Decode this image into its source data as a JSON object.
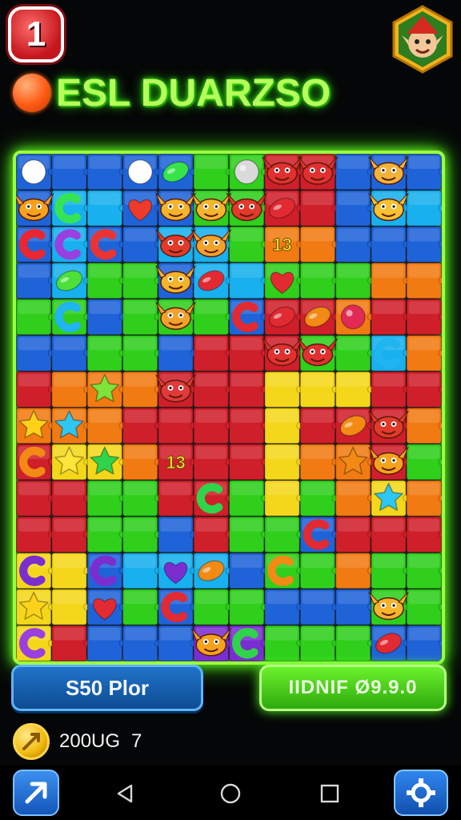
{
  "header": {
    "level_badge": "1",
    "title": "ESL DUARZSO",
    "avatar_icon": "elf-avatar-icon",
    "title_orb_icon": "orange-orb-icon"
  },
  "board": {
    "rows": 14,
    "cols": 12,
    "grid": [
      [
        "B",
        "B",
        "B",
        "B",
        "B",
        "G",
        "G",
        "R",
        "R",
        "B",
        "B",
        "B"
      ],
      [
        "B",
        "C",
        "C",
        "B",
        "B",
        "G",
        "G",
        "R",
        "R",
        "B",
        "C",
        "C"
      ],
      [
        "B",
        "C",
        "B",
        "B",
        "C",
        "C",
        "G",
        "O",
        "O",
        "B",
        "B",
        "B"
      ],
      [
        "B",
        "C",
        "G",
        "G",
        "B",
        "C",
        "C",
        "G",
        "G",
        "G",
        "O",
        "O"
      ],
      [
        "G",
        "G",
        "B",
        "G",
        "G",
        "G",
        "B",
        "R",
        "R",
        "O",
        "R",
        "R"
      ],
      [
        "B",
        "B",
        "G",
        "G",
        "B",
        "R",
        "R",
        "R",
        "G",
        "G",
        "C",
        "O"
      ],
      [
        "R",
        "O",
        "O",
        "O",
        "R",
        "R",
        "R",
        "Y",
        "Y",
        "Y",
        "R",
        "R"
      ],
      [
        "O",
        "O",
        "O",
        "R",
        "R",
        "R",
        "R",
        "Y",
        "R",
        "R",
        "R",
        "O"
      ],
      [
        "R",
        "Y",
        "Y",
        "O",
        "R",
        "R",
        "R",
        "Y",
        "O",
        "O",
        "R",
        "G"
      ],
      [
        "R",
        "R",
        "G",
        "G",
        "R",
        "R",
        "G",
        "Y",
        "G",
        "O",
        "Y",
        "O"
      ],
      [
        "R",
        "R",
        "G",
        "G",
        "B",
        "R",
        "G",
        "G",
        "B",
        "R",
        "R",
        "R"
      ],
      [
        "Y",
        "Y",
        "B",
        "C",
        "C",
        "C",
        "B",
        "G",
        "G",
        "O",
        "G",
        "G"
      ],
      [
        "Y",
        "Y",
        "B",
        "G",
        "B",
        "G",
        "G",
        "B",
        "B",
        "B",
        "G",
        "G"
      ],
      [
        "Y",
        "R",
        "B",
        "B",
        "B",
        "P",
        "P",
        "G",
        "G",
        "G",
        "B",
        "B"
      ]
    ],
    "colors": {
      "B": "#1f63d8",
      "C": "#18b0ee",
      "G": "#2fcf1c",
      "R": "#cf1f2a",
      "O": "#f27a12",
      "Y": "#f4d71a",
      "P": "#7a2ed0"
    },
    "pieces": [
      {
        "r": 0,
        "c": 0,
        "icon": "wave-ghost-icon"
      },
      {
        "r": 0,
        "c": 3,
        "icon": "ring-candy-icon"
      },
      {
        "r": 0,
        "c": 4,
        "icon": "jelly-bean-icon",
        "color": "#37e34a"
      },
      {
        "r": 0,
        "c": 6,
        "icon": "shell-icon",
        "color": "#dadada"
      },
      {
        "r": 0,
        "c": 7,
        "icon": "crab-monster-icon",
        "color": "#e23030"
      },
      {
        "r": 0,
        "c": 8,
        "icon": "crab-monster-icon",
        "color": "#e23030"
      },
      {
        "r": 0,
        "c": 10,
        "icon": "crab-monster-icon",
        "color": "#f1b43a"
      },
      {
        "r": 1,
        "c": 0,
        "icon": "crab-monster-icon",
        "color": "#f7a21c"
      },
      {
        "r": 1,
        "c": 1,
        "icon": "claw-candy-icon",
        "color": "#34e454"
      },
      {
        "r": 1,
        "c": 3,
        "icon": "heart-candy-icon",
        "color": "#ee3a2a"
      },
      {
        "r": 1,
        "c": 4,
        "icon": "crab-monster-icon",
        "color": "#f5b42a"
      },
      {
        "r": 1,
        "c": 5,
        "icon": "crab-monster-icon",
        "color": "#f3b52b"
      },
      {
        "r": 1,
        "c": 6,
        "icon": "crab-monster-icon",
        "color": "#e23a2a"
      },
      {
        "r": 1,
        "c": 7,
        "icon": "bean-candy-icon",
        "color": "#e22a33"
      },
      {
        "r": 1,
        "c": 10,
        "icon": "crab-monster-icon",
        "color": "#f7c12f"
      },
      {
        "r": 2,
        "c": 0,
        "icon": "hook-candy-icon",
        "color": "#ea2631"
      },
      {
        "r": 2,
        "c": 1,
        "icon": "hook-candy-icon",
        "color": "#9a3fe0"
      },
      {
        "r": 2,
        "c": 2,
        "icon": "hook-candy-icon",
        "color": "#ea3434"
      },
      {
        "r": 2,
        "c": 4,
        "icon": "crab-monster-icon",
        "color": "#e23a2a"
      },
      {
        "r": 2,
        "c": 5,
        "icon": "crab-monster-icon",
        "color": "#f1a22b"
      },
      {
        "r": 2,
        "c": 7,
        "icon": "number-candy-icon",
        "label": "13",
        "color": "#ffe43a"
      },
      {
        "r": 3,
        "c": 1,
        "icon": "jelly-bean-icon",
        "color": "#4ce038"
      },
      {
        "r": 3,
        "c": 4,
        "icon": "crab-monster-icon",
        "color": "#f3b52b"
      },
      {
        "r": 3,
        "c": 5,
        "icon": "shoe-candy-icon",
        "color": "#e22a33"
      },
      {
        "r": 3,
        "c": 7,
        "icon": "apple-candy-icon",
        "color": "#e22a33"
      },
      {
        "r": 4,
        "c": 1,
        "icon": "hook-candy-icon",
        "color": "#20b4f0"
      },
      {
        "r": 4,
        "c": 4,
        "icon": "crab-monster-icon",
        "color": "#f1a22b"
      },
      {
        "r": 4,
        "c": 6,
        "icon": "hook-candy-icon",
        "color": "#e22a33"
      },
      {
        "r": 4,
        "c": 7,
        "icon": "bean-candy-icon",
        "color": "#e22a33"
      },
      {
        "r": 4,
        "c": 8,
        "icon": "bean-candy-icon",
        "color": "#f28a14"
      },
      {
        "r": 4,
        "c": 9,
        "icon": "berry-candy-icon",
        "color": "#e22a55"
      },
      {
        "r": 5,
        "c": 7,
        "icon": "crab-monster-icon",
        "color": "#e23030"
      },
      {
        "r": 5,
        "c": 8,
        "icon": "crab-monster-icon",
        "color": "#e23030"
      },
      {
        "r": 5,
        "c": 10,
        "icon": "hook-candy-icon",
        "color": "#20b4f0"
      },
      {
        "r": 6,
        "c": 2,
        "icon": "star-candy-icon",
        "color": "#7fe33a"
      },
      {
        "r": 6,
        "c": 4,
        "icon": "crab-monster-icon",
        "color": "#e23a3a"
      },
      {
        "r": 7,
        "c": 0,
        "icon": "star-candy-icon",
        "color": "#ffd21a"
      },
      {
        "r": 7,
        "c": 1,
        "icon": "star-candy-icon",
        "color": "#2ec7f2"
      },
      {
        "r": 7,
        "c": 9,
        "icon": "bean-candy-icon",
        "color": "#f28a14"
      },
      {
        "r": 7,
        "c": 10,
        "icon": "crab-monster-icon",
        "color": "#e23a2a"
      },
      {
        "r": 8,
        "c": 0,
        "icon": "hook-candy-icon",
        "color": "#f28a14"
      },
      {
        "r": 8,
        "c": 1,
        "icon": "star-candy-icon",
        "color": "#ffe43a"
      },
      {
        "r": 8,
        "c": 2,
        "icon": "star-candy-icon",
        "color": "#2fd44a"
      },
      {
        "r": 8,
        "c": 4,
        "icon": "number-candy-icon",
        "label": "13",
        "color": "#ffe43a"
      },
      {
        "r": 8,
        "c": 9,
        "icon": "star-candy-icon",
        "color": "#f28a14"
      },
      {
        "r": 8,
        "c": 10,
        "icon": "crab-monster-icon",
        "color": "#f5a21c"
      },
      {
        "r": 9,
        "c": 5,
        "icon": "claw-candy-icon",
        "color": "#2fd44a"
      },
      {
        "r": 9,
        "c": 10,
        "icon": "star-candy-icon",
        "color": "#2ec7f2"
      },
      {
        "r": 10,
        "c": 8,
        "icon": "hook-candy-icon",
        "color": "#e22a33"
      },
      {
        "r": 11,
        "c": 0,
        "icon": "hook-candy-icon",
        "color": "#7a2ed0"
      },
      {
        "r": 11,
        "c": 2,
        "icon": "hook-candy-icon",
        "color": "#7a2ed0"
      },
      {
        "r": 11,
        "c": 4,
        "icon": "heart-candy-icon",
        "color": "#7a2ed0"
      },
      {
        "r": 11,
        "c": 5,
        "icon": "bean-candy-icon",
        "color": "#f28a14"
      },
      {
        "r": 11,
        "c": 7,
        "icon": "hook-candy-icon",
        "color": "#f28a14"
      },
      {
        "r": 12,
        "c": 0,
        "icon": "star-candy-icon",
        "color": "#ffd21a"
      },
      {
        "r": 12,
        "c": 2,
        "icon": "heart-candy-icon",
        "color": "#e22a33"
      },
      {
        "r": 12,
        "c": 4,
        "icon": "hook-candy-icon",
        "color": "#e22a33"
      },
      {
        "r": 12,
        "c": 10,
        "icon": "crab-monster-icon",
        "color": "#f5b42a"
      },
      {
        "r": 13,
        "c": 0,
        "icon": "claw-candy-icon",
        "color": "#9a3fe0"
      },
      {
        "r": 13,
        "c": 5,
        "icon": "crab-monster-icon",
        "color": "#f5a21c"
      },
      {
        "r": 13,
        "c": 6,
        "icon": "claw-candy-icon",
        "color": "#2fd44a"
      },
      {
        "r": 13,
        "c": 10,
        "icon": "bean-candy-icon",
        "color": "#e22a33"
      }
    ]
  },
  "buttons": {
    "left_label": "S50 Plor",
    "right_label": "IIDNIF Ø9.9.0"
  },
  "status": {
    "coin_icon": "gold-coin-icon",
    "value": "200UG",
    "count": "7"
  },
  "navbar": {
    "left_button_icon": "arrow-up-right-icon",
    "right_button_icon": "puzzle-gear-icon",
    "back_icon": "back-triangle-icon",
    "home_icon": "home-circle-icon",
    "recent_icon": "recent-square-icon"
  }
}
